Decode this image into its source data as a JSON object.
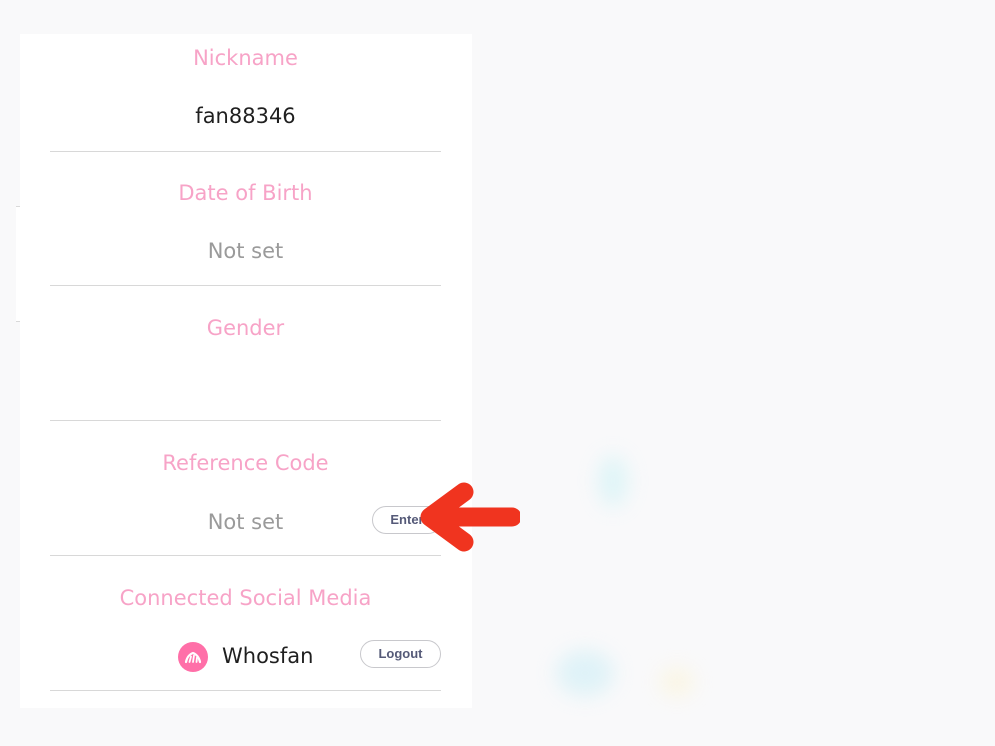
{
  "profile": {
    "nickname": {
      "label": "Nickname",
      "value": "fan88346"
    },
    "date_of_birth": {
      "label": "Date of Birth",
      "value": "Not set"
    },
    "gender": {
      "label": "Gender",
      "value": ""
    },
    "reference_code": {
      "label": "Reference Code",
      "value": "Not set",
      "button_label": "Enter"
    },
    "connected_social_media": {
      "label": "Connected Social Media",
      "service_name": "Whosfan",
      "button_label": "Logout",
      "icon": "whosfan-logo-icon"
    }
  },
  "annotation": {
    "icon": "red-arrow-left-icon",
    "color": "#f0341f"
  },
  "colors": {
    "label_pink": "#f7a3c7",
    "whosfan_pink": "#ff6fa8",
    "value_dark": "#1f1f1f",
    "value_muted": "#9a9a9a",
    "button_text": "#555a78"
  }
}
